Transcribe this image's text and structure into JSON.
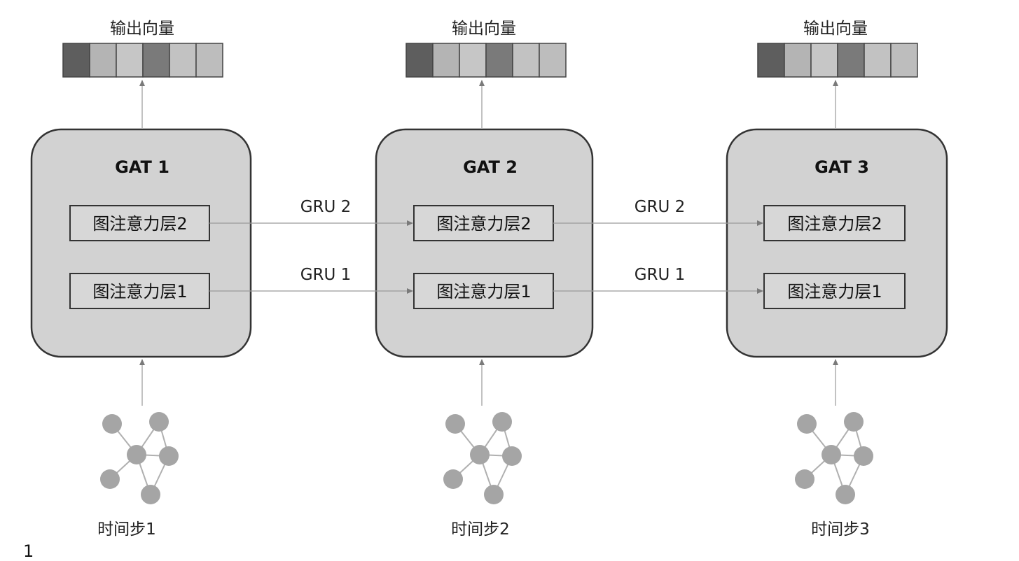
{
  "output_label": "输出向量",
  "blocks": [
    {
      "title": "GAT 1",
      "layer_top": "图注意力层2",
      "layer_bottom": "图注意力层1",
      "timestep": "时间步1"
    },
    {
      "title": "GAT 2",
      "layer_top": "图注意力层2",
      "layer_bottom": "图注意力层1",
      "timestep": "时间步2"
    },
    {
      "title": "GAT 3",
      "layer_top": "图注意力层2",
      "layer_bottom": "图注意力层1",
      "timestep": "时间步3"
    }
  ],
  "connections": [
    {
      "top": "GRU 2",
      "bottom": "GRU 1"
    },
    {
      "top": "GRU 2",
      "bottom": "GRU 1"
    }
  ],
  "page_number": "1",
  "colors": {
    "block_fill": "#d2d2d2",
    "block_stroke": "#333333",
    "node_fill": "#a5a5a5",
    "edge": "#b0b0b0",
    "arrow": "#8a8a8a",
    "vector_cells": [
      "#5e5e5e",
      "#b4b4b4",
      "#c6c6c6",
      "#7a7a7a",
      "#c2c2c2",
      "#bdbdbd"
    ]
  }
}
